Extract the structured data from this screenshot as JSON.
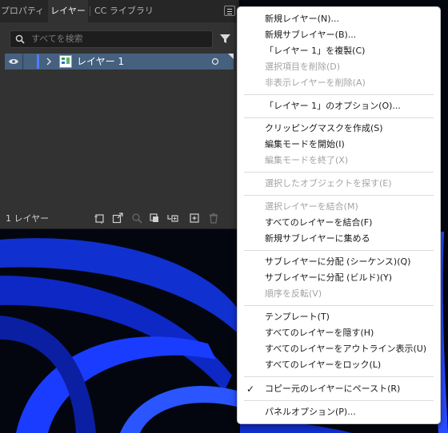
{
  "panel": {
    "tabs": [
      {
        "label": "プロパティ",
        "active": false
      },
      {
        "label": "レイヤー",
        "active": true
      },
      {
        "label": "CC ライブラリ",
        "active": false
      }
    ],
    "search_placeholder": "すべてを検索",
    "layer": {
      "name": "レイヤー 1",
      "color": "#4f7dff"
    },
    "footer": {
      "count_label": "1 レイヤー"
    }
  },
  "menu": {
    "items": [
      {
        "label": "新規レイヤー(N)...",
        "enabled": true
      },
      {
        "label": "新規サブレイヤー(B)...",
        "enabled": true
      },
      {
        "label": "「レイヤー 1」を複製(C)",
        "enabled": true
      },
      {
        "label": "選択項目を削除(D)",
        "enabled": false
      },
      {
        "label": "非表示レイヤーを削除(A)",
        "enabled": false
      },
      {
        "label": "「レイヤー 1」のオプション(O)...",
        "enabled": true
      },
      {
        "label": "クリッピングマスクを作成(S)",
        "enabled": true
      },
      {
        "label": "編集モードを開始(I)",
        "enabled": true
      },
      {
        "label": "編集モードを終了(X)",
        "enabled": false
      },
      {
        "label": "選択したオブジェクトを探す(E)",
        "enabled": false
      },
      {
        "label": "選択レイヤーを結合(M)",
        "enabled": false
      },
      {
        "label": "すべてのレイヤーを結合(F)",
        "enabled": true
      },
      {
        "label": "新規サブレイヤーに集める",
        "enabled": true
      },
      {
        "label": "サブレイヤーに分配 (シーケンス)(Q)",
        "enabled": true
      },
      {
        "label": "サブレイヤーに分配 (ビルド)(Y)",
        "enabled": true
      },
      {
        "label": "順序を反転(V)",
        "enabled": false
      },
      {
        "label": "テンプレート(T)",
        "enabled": true
      },
      {
        "label": "すべてのレイヤーを隠す(H)",
        "enabled": true
      },
      {
        "label": "すべてのレイヤーをアウトライン表示(U)",
        "enabled": true
      },
      {
        "label": "すべてのレイヤーをロック(L)",
        "enabled": true
      },
      {
        "label": "コピー元のレイヤーにペースト(R)",
        "enabled": true,
        "checked": true
      },
      {
        "label": "パネルオプション(P)...",
        "enabled": true
      }
    ]
  },
  "colors": {
    "accent": "#4f7dff",
    "selection": "#46607f",
    "wallpaper": "#0b2bd8"
  }
}
